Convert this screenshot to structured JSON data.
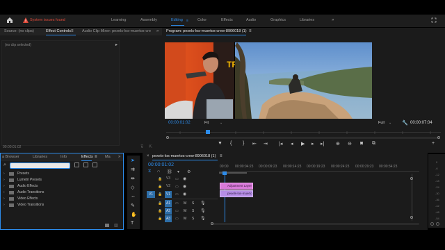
{
  "topbar": {
    "warning_text": "System issues found",
    "workspaces": [
      "Learning",
      "Assembly",
      "Editing",
      "Color",
      "Effects",
      "Audio",
      "Graphics",
      "Libraries"
    ],
    "active_workspace": "Editing"
  },
  "source_panel": {
    "tabs": [
      "Source: (no clips)",
      "Effect Controls",
      "Audio Clip Mixer: pexels-los-muertos-cre"
    ],
    "active_tab": "Effect Controls",
    "no_clip_label": "(no clip selected)",
    "timecode": "00:00:01:02"
  },
  "program_monitor": {
    "title": "Program: pexels-los-muertos-crew-8906018 (1)",
    "timecode": "00:00:01:02",
    "fit_label": "Fit",
    "quality_label": "Full",
    "duration": "00:00:07:04",
    "overlay_text": "TF"
  },
  "effects_panel": {
    "tabs": [
      "a Browser",
      "Libraries",
      "Info",
      "Effects",
      "Ma"
    ],
    "active_tab": "Effects",
    "search_value": "",
    "tree_items": [
      "Presets",
      "Lumetri Presets",
      "Audio Effects",
      "Audio Transitions",
      "Video Effects",
      "Video Transitions"
    ]
  },
  "timeline": {
    "title": "pexels-los-muertos-crew-8906018 (1)",
    "timecode": "00:00:01:02",
    "ruler_ticks": [
      "00:00",
      "00:00:04:23",
      "00:00:09:23",
      "00:00:14:23",
      "00:00:19:23",
      "00:00:24:23",
      "00:00:29:23",
      "00:00:34:23"
    ],
    "tracks": [
      {
        "label": "V3",
        "src": ""
      },
      {
        "label": "V2",
        "src": ""
      },
      {
        "label": "V1",
        "src": "V1"
      },
      {
        "label": "A1",
        "src": ""
      },
      {
        "label": "A2",
        "src": ""
      },
      {
        "label": "A3",
        "src": ""
      }
    ],
    "clips": [
      {
        "label": "Adjustment Layer",
        "track": "V2",
        "color": "#d97ad9"
      },
      {
        "label": "pexels-los-muerto",
        "track": "V1",
        "color": "#b68ee6"
      }
    ],
    "audio_meter_labels": [
      "0",
      "-6",
      "-12",
      "-18",
      "-24",
      "-30",
      "-36",
      "-42",
      "-48",
      "-54"
    ]
  },
  "colors": {
    "accent": "#2d8ceb",
    "warning": "#e04a3a",
    "adjustment_clip": "#d97ad9",
    "video_clip": "#b68ee6"
  }
}
